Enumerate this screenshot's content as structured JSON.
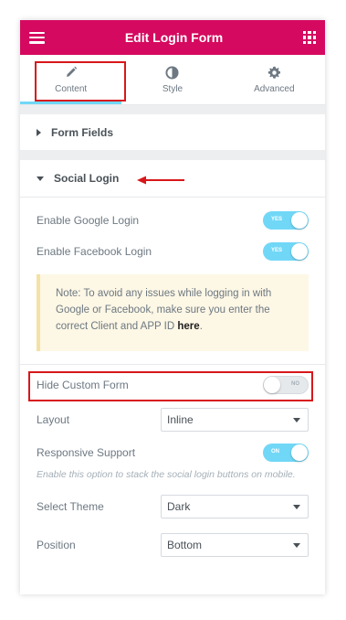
{
  "header": {
    "title": "Edit Login Form"
  },
  "tabs": [
    {
      "label": "Content",
      "icon": "pencil-icon"
    },
    {
      "label": "Style",
      "icon": "half-circle-icon"
    },
    {
      "label": "Advanced",
      "icon": "gear-icon"
    }
  ],
  "sections": {
    "form_fields": {
      "title": "Form Fields"
    },
    "social_login": {
      "title": "Social Login"
    }
  },
  "controls": {
    "google": {
      "label": "Enable Google Login",
      "state": "YES"
    },
    "facebook": {
      "label": "Enable Facebook Login",
      "state": "YES"
    },
    "note": {
      "text": "Note: To avoid any issues while logging in with Google or Facebook, make sure you enter the correct Client and APP ID ",
      "link": "here",
      "suffix": "."
    },
    "hide_custom_form": {
      "label": "Hide Custom Form",
      "state": "NO"
    },
    "layout": {
      "label": "Layout",
      "value": "Inline"
    },
    "responsive": {
      "label": "Responsive Support",
      "state": "ON",
      "description": "Enable this option to stack the social login buttons on mobile."
    },
    "theme": {
      "label": "Select Theme",
      "value": "Dark"
    },
    "position": {
      "label": "Position",
      "value": "Bottom"
    }
  },
  "colors": {
    "brand": "#d5095f",
    "toggle_on": "#71d7f7",
    "highlight": "#d8171b"
  }
}
